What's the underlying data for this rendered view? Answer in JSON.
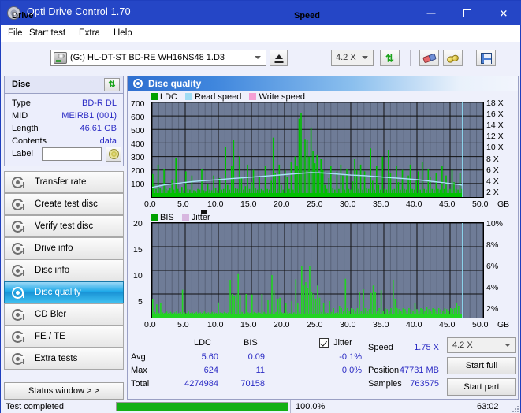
{
  "window": {
    "title": "Opti Drive Control 1.70",
    "icon": "disc-icon",
    "minimize": "–",
    "maximize": "□",
    "close": "✕"
  },
  "menu": {
    "items": [
      "File",
      "Start test",
      "Extra",
      "Help"
    ]
  },
  "toolbar": {
    "drive_label": "Drive",
    "drive_value": "(G:)  HL-DT-ST BD-RE  WH16NS48 1.D3",
    "eject": "eject-icon",
    "speed_label": "Speed",
    "speed_value": "4.2 X",
    "icons": [
      "refresh-icon",
      "eraser-icon",
      "plug-icon",
      "save-icon"
    ]
  },
  "disc_panel": {
    "header": "Disc",
    "refresh_icon": "refresh-icon",
    "rows": [
      {
        "key": "Type",
        "value": "BD-R DL"
      },
      {
        "key": "MID",
        "value": "MEIRB1 (001)"
      },
      {
        "key": "Length",
        "value": "46.61 GB"
      },
      {
        "key": "Contents",
        "value": "data"
      }
    ],
    "label_key": "Label",
    "label_value": "",
    "label_placeholder": ""
  },
  "sidebar": {
    "items": [
      {
        "label": "Transfer rate",
        "selected": false
      },
      {
        "label": "Create test disc",
        "selected": false
      },
      {
        "label": "Verify test disc",
        "selected": false
      },
      {
        "label": "Drive info",
        "selected": false
      },
      {
        "label": "Disc info",
        "selected": false
      },
      {
        "label": "Disc quality",
        "selected": true
      },
      {
        "label": "CD Bler",
        "selected": false
      },
      {
        "label": "FE / TE",
        "selected": false
      },
      {
        "label": "Extra tests",
        "selected": false
      }
    ],
    "status_window": "Status window > >"
  },
  "content": {
    "title": "Disc quality",
    "icon": "disc-quality-icon"
  },
  "chart_data": [
    {
      "type": "line",
      "id": "ldc-chart",
      "title": "",
      "legend": [
        {
          "label": "LDC",
          "color": "#00b000"
        },
        {
          "label": "Read speed",
          "color": "#9fdcf4"
        },
        {
          "label": "Write speed",
          "color": "#f49fd4"
        }
      ],
      "legend_position": "top-left",
      "xlabel": "GB",
      "ylabel": "",
      "xlim": [
        0,
        50
      ],
      "ylim": [
        0,
        700
      ],
      "y2lim": [
        0,
        18.5
      ],
      "y2label": "X",
      "xticks": [
        "0.0",
        "5.0",
        "10.0",
        "15.0",
        "20.0",
        "25.0",
        "30.0",
        "35.0",
        "40.0",
        "45.0",
        "50.0"
      ],
      "yticks": [
        100,
        200,
        300,
        400,
        500,
        600,
        700
      ],
      "y2ticks": [
        "2 X",
        "4 X",
        "6 X",
        "8 X",
        "10 X",
        "12 X",
        "14 X",
        "16 X",
        "18 X"
      ],
      "grid": true,
      "bg": "#6f7c97",
      "series": [
        {
          "name": "LDC",
          "type": "spikes",
          "color": "#00c000",
          "x": [
            0.1,
            0.3,
            0.6,
            0.9,
            1.2,
            1.5,
            1.8,
            2.1,
            2.4,
            2.7,
            3.0,
            3.3,
            3.6,
            3.9,
            4.2,
            4.5,
            4.8,
            5.1,
            5.4,
            5.7,
            6.0,
            6.3,
            6.6,
            6.9,
            7.2,
            7.5,
            7.8,
            8.1,
            8.4,
            8.7,
            9.0,
            9.3,
            9.6,
            9.9,
            10.2,
            10.5,
            10.8,
            11.1,
            11.4,
            11.7,
            12.0,
            12.3,
            12.6,
            12.9,
            13.2,
            13.5,
            13.8,
            14.1,
            14.4,
            14.7,
            15.0,
            15.3,
            15.6,
            15.9,
            16.2,
            16.5,
            16.8,
            17.1,
            17.4,
            17.7,
            18.0,
            18.3,
            18.6,
            18.9,
            19.2,
            19.5,
            19.8,
            20.1,
            20.4,
            20.7,
            21.0,
            21.3,
            21.6,
            21.9,
            22.2,
            22.5,
            22.8,
            23.1,
            23.4,
            23.7,
            24.0,
            24.3,
            24.6,
            24.9,
            25.2,
            25.5,
            25.8,
            26.1,
            26.4,
            26.7,
            27.0,
            27.3,
            27.6,
            27.9,
            28.2,
            28.5,
            28.8,
            29.1,
            29.4,
            29.7,
            30.0,
            30.3,
            30.6,
            30.9,
            31.2,
            31.5,
            31.8,
            32.1,
            32.4,
            32.7,
            33.0,
            33.3,
            33.6,
            33.9,
            34.2,
            34.5,
            34.8,
            35.1,
            35.4,
            35.7,
            36.0,
            36.3,
            36.6,
            36.9,
            37.2,
            37.5,
            37.8,
            38.1,
            38.4,
            38.7,
            39.0,
            39.3,
            39.6,
            39.9,
            40.2,
            40.5,
            40.8,
            41.1,
            41.4,
            41.7,
            42.0,
            42.3,
            42.6,
            42.9,
            43.2,
            43.5,
            43.8,
            44.1,
            44.4,
            44.7,
            45.0,
            45.3,
            45.6,
            45.9,
            46.2,
            46.5,
            46.8
          ],
          "values": [
            170,
            95,
            60,
            240,
            70,
            55,
            210,
            60,
            50,
            65,
            130,
            55,
            290,
            60,
            45,
            75,
            50,
            190,
            60,
            55,
            160,
            50,
            45,
            60,
            55,
            210,
            50,
            45,
            95,
            55,
            50,
            160,
            65,
            50,
            140,
            55,
            60,
            370,
            90,
            55,
            230,
            420,
            70,
            60,
            300,
            150,
            55,
            80,
            240,
            60,
            110,
            200,
            70,
            55,
            150,
            60,
            50,
            230,
            60,
            55,
            120,
            440,
            180,
            60,
            240,
            90,
            55,
            200,
            150,
            60,
            260,
            55,
            300,
            230,
            580,
            620,
            300,
            430,
            420,
            300,
            515,
            340,
            250,
            310,
            180,
            280,
            200,
            90,
            60,
            140,
            230,
            65,
            55,
            190,
            60,
            240,
            160,
            55,
            210,
            60,
            55,
            115,
            280,
            200,
            60,
            240,
            55,
            190,
            70,
            60,
            360,
            120,
            55,
            230,
            90,
            55,
            300,
            60,
            55,
            350,
            180,
            55,
            60,
            230,
            110,
            55,
            200,
            60,
            55,
            160,
            240,
            60,
            55,
            120,
            190,
            55,
            260,
            60,
            55,
            210,
            150,
            60,
            55,
            180,
            60,
            55,
            230,
            60,
            160,
            55,
            60,
            200,
            110,
            60,
            55,
            180,
            60
          ]
        },
        {
          "name": "Read speed",
          "type": "line",
          "color": "#a9e2f7",
          "x": [
            0,
            2,
            4,
            6,
            8,
            10,
            12,
            14,
            16,
            18,
            20,
            22,
            24,
            26,
            28,
            30,
            32,
            34,
            36,
            38,
            40,
            42,
            44,
            46,
            46.9
          ],
          "values": [
            1.9,
            2.4,
            2.7,
            3.0,
            3.2,
            3.4,
            3.6,
            3.8,
            4.0,
            4.2,
            4.4,
            4.6,
            4.8,
            4.7,
            4.5,
            4.3,
            4.2,
            4.0,
            3.8,
            3.6,
            3.4,
            3.1,
            2.8,
            2.5,
            2.3
          ],
          "axis": "y2"
        },
        {
          "name": "Write speed",
          "type": "line",
          "color": "#f49fd4",
          "x": [],
          "values": []
        }
      ],
      "marker_line": {
        "x": 46.9,
        "color": "#8fe3fa"
      }
    },
    {
      "type": "line",
      "id": "bis-chart",
      "title": "",
      "legend": [
        {
          "label": "BIS",
          "color": "#00b000"
        },
        {
          "label": "Jitter",
          "color": "#d8b7e0"
        }
      ],
      "legend_position": "top-left",
      "xlabel": "GB",
      "ylabel": "",
      "xlim": [
        0,
        50
      ],
      "ylim": [
        0,
        20
      ],
      "y2lim": [
        0,
        10
      ],
      "y2label": "%",
      "xticks": [
        "0.0",
        "5.0",
        "10.0",
        "15.0",
        "20.0",
        "25.0",
        "30.0",
        "35.0",
        "40.0",
        "45.0",
        "50.0"
      ],
      "yticks": [
        5,
        10,
        15,
        20
      ],
      "y2ticks": [
        "2%",
        "4%",
        "6%",
        "8%",
        "10%"
      ],
      "grid": true,
      "bg": "#6f7c97",
      "series": [
        {
          "name": "BIS",
          "type": "spikes",
          "color": "#22d422",
          "x": [
            0.1,
            0.4,
            0.7,
            1.0,
            1.3,
            1.6,
            1.9,
            2.2,
            2.5,
            2.8,
            3.1,
            3.4,
            3.7,
            4.0,
            4.3,
            4.6,
            4.9,
            5.2,
            5.5,
            5.8,
            6.1,
            6.4,
            6.7,
            7.0,
            7.3,
            7.6,
            7.9,
            8.2,
            8.5,
            8.8,
            9.1,
            9.4,
            9.7,
            10.0,
            10.3,
            10.6,
            10.9,
            11.2,
            11.5,
            11.8,
            12.1,
            12.4,
            12.7,
            13.0,
            13.3,
            13.6,
            13.9,
            14.2,
            14.5,
            14.8,
            15.1,
            15.4,
            15.7,
            16.0,
            16.3,
            16.6,
            16.9,
            17.2,
            17.5,
            17.8,
            18.1,
            18.4,
            18.7,
            19.0,
            19.3,
            19.6,
            19.9,
            20.2,
            20.5,
            20.8,
            21.1,
            21.4,
            21.7,
            22.0,
            22.3,
            22.6,
            22.9,
            23.2,
            23.5,
            23.8,
            24.1,
            24.4,
            24.7,
            25.0,
            25.3,
            25.6,
            25.9,
            26.2,
            26.5,
            26.8,
            27.1,
            27.4,
            27.7,
            28.0,
            28.3,
            28.6,
            28.9,
            29.2,
            29.5,
            29.8,
            30.1,
            30.4,
            30.7,
            31.0,
            31.3,
            31.6,
            31.9,
            32.2,
            32.5,
            32.8,
            33.1,
            33.4,
            33.7,
            34.0,
            34.3,
            34.6,
            34.9,
            35.2,
            35.5,
            35.8,
            36.1,
            36.4,
            36.7,
            37.0,
            37.3,
            37.6,
            37.9,
            38.2,
            38.5,
            38.8,
            39.1,
            39.4,
            39.7,
            40.0,
            40.3,
            40.6,
            40.9,
            41.2,
            41.5,
            41.8,
            42.1,
            42.4,
            42.7,
            43.0,
            43.3,
            43.6,
            43.9,
            44.2,
            44.5,
            44.8,
            45.1,
            45.4,
            45.7,
            46.0,
            46.3,
            46.6,
            46.8
          ],
          "values": [
            4.0,
            1.2,
            2.8,
            1.0,
            3.0,
            1.1,
            1.0,
            1.3,
            1.0,
            1.2,
            1.0,
            1.1,
            1.4,
            1.0,
            1.2,
            5.9,
            1.1,
            1.0,
            1.3,
            1.0,
            1.1,
            1.0,
            1.2,
            1.0,
            1.1,
            1.0,
            1.3,
            1.0,
            1.1,
            1.0,
            1.2,
            1.1,
            1.0,
            3.2,
            1.1,
            1.0,
            1.2,
            1.0,
            1.1,
            8.0,
            5.0,
            4.5,
            5.0,
            9.2,
            4.8,
            1.2,
            1.0,
            5.0,
            1.1,
            1.0,
            4.9,
            1.2,
            1.0,
            1.1,
            1.0,
            5.0,
            1.2,
            1.0,
            3.8,
            1.1,
            9.0,
            5.8,
            1.2,
            4.0,
            4.2,
            1.1,
            1.0,
            3.0,
            1.2,
            1.0,
            3.5,
            1.1,
            8.1,
            3.0,
            1.2,
            11.0,
            6.8,
            7.5,
            6.3,
            11.0,
            5.5,
            5.0,
            4.0,
            6.8,
            4.2,
            1.2,
            3.0,
            1.1,
            1.0,
            3.5,
            1.2,
            2.0,
            1.0,
            1.1,
            2.5,
            2.0,
            1.5,
            8.2,
            2.0,
            1.5,
            2.0,
            1.8,
            1.5,
            2.0,
            5.5,
            1.5,
            6.0,
            2.0,
            1.5,
            1.8,
            5.2,
            6.8,
            5.5,
            1.5,
            2.0,
            5.8,
            1.5,
            2.0,
            1.8,
            1.5,
            2.0,
            8.0,
            4.0,
            2.0,
            1.8,
            1.5,
            2.0,
            1.8,
            1.5,
            2.0,
            1.8,
            1.5,
            3.0,
            1.8,
            1.5,
            2.0,
            1.8,
            1.5,
            2.2,
            1.8,
            1.5,
            2.0,
            1.8,
            1.5,
            2.0,
            1.8,
            1.5,
            2.0,
            1.8,
            1.5,
            2.0,
            1.8,
            2.0,
            3.0,
            2.5
          ]
        },
        {
          "name": "Jitter",
          "type": "line",
          "color": "#d8b7e0",
          "x": [],
          "values": []
        }
      ],
      "marker_line": {
        "x": 46.9,
        "color": "#8fe3fa"
      }
    }
  ],
  "stats": {
    "col_headers": [
      "LDC",
      "BIS"
    ],
    "row_labels": [
      "Avg",
      "Max",
      "Total"
    ],
    "ldc": {
      "avg": "5.60",
      "max": "624",
      "total": "4274984"
    },
    "bis": {
      "avg": "0.09",
      "max": "11",
      "total": "70158"
    },
    "jitter_label": "Jitter",
    "jitter_checked": true,
    "jitter_avg": "-0.1%",
    "jitter_max": "0.0%",
    "speed_label": "Speed",
    "speed_value": "1.75 X",
    "position_label": "Position",
    "position_value": "47731 MB",
    "samples_label": "Samples",
    "samples_value": "763575",
    "speed_select": "4.2 X",
    "start_full": "Start full",
    "start_part": "Start part"
  },
  "statusbar": {
    "message": "Test completed",
    "progress_percent": "100.0%",
    "progress_value": 100,
    "elapsed": "63:02"
  }
}
